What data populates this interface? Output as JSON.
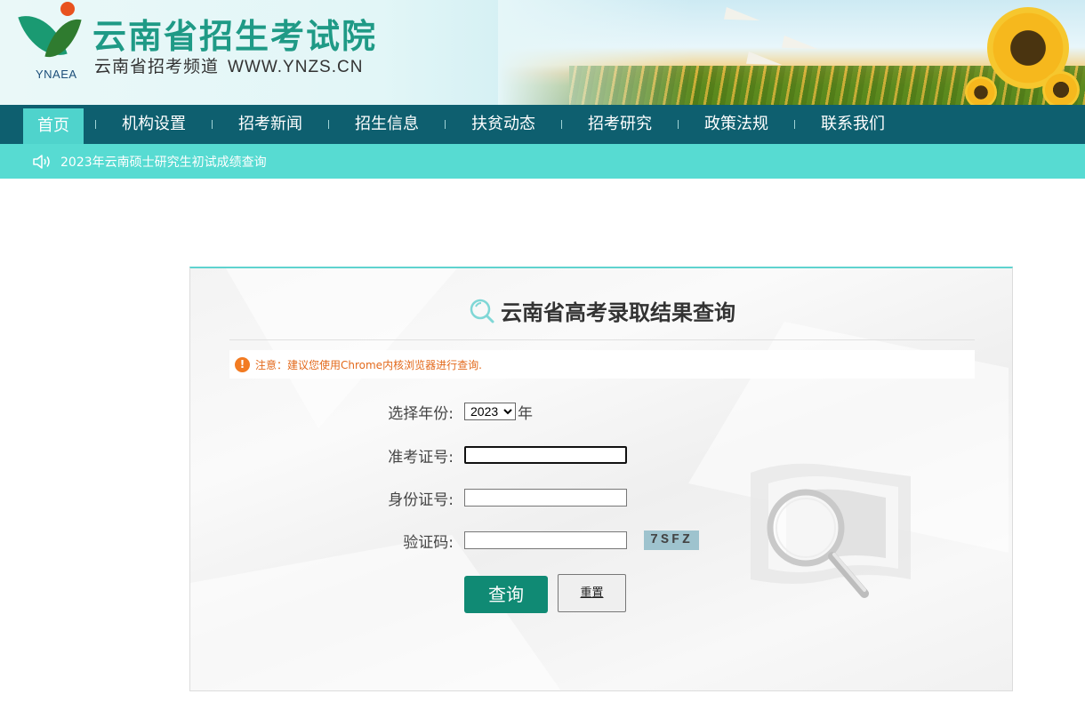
{
  "header": {
    "logo_abbr": "YNAEA",
    "title": "云南省招生考试院",
    "subtitle": "云南省招考频道",
    "url": "WWW.YNZS.CN"
  },
  "nav": {
    "items": [
      {
        "label": "首页",
        "active": true
      },
      {
        "label": "机构设置"
      },
      {
        "label": "招考新闻"
      },
      {
        "label": "招生信息"
      },
      {
        "label": "扶贫动态"
      },
      {
        "label": "招考研究"
      },
      {
        "label": "政策法规"
      },
      {
        "label": "联系我们"
      }
    ]
  },
  "notice": {
    "icon": "speaker-icon",
    "text": "2023年云南硕士研究生初试成绩查询"
  },
  "panel": {
    "title": "云南省高考录取结果查询",
    "tip": "注意：建议您使用Chrome内核浏览器进行查询.",
    "form": {
      "year_label": "选择年份:",
      "year_value": "2023",
      "year_suffix": "年",
      "exam_id_label": "准考证号:",
      "exam_id_value": "",
      "id_card_label": "身份证号:",
      "id_card_value": "",
      "captcha_label": "验证码:",
      "captcha_value": "",
      "captcha_code": "7SFZ"
    },
    "buttons": {
      "query": "查询",
      "reset": "重置"
    }
  },
  "colors": {
    "nav_bg": "#0e5f6f",
    "nav_active": "#4fd3cc",
    "notice_bg": "#57dbd2",
    "query_btn": "#108a74",
    "tip_text": "#e36a1c",
    "brand_title": "#1f9a86"
  }
}
